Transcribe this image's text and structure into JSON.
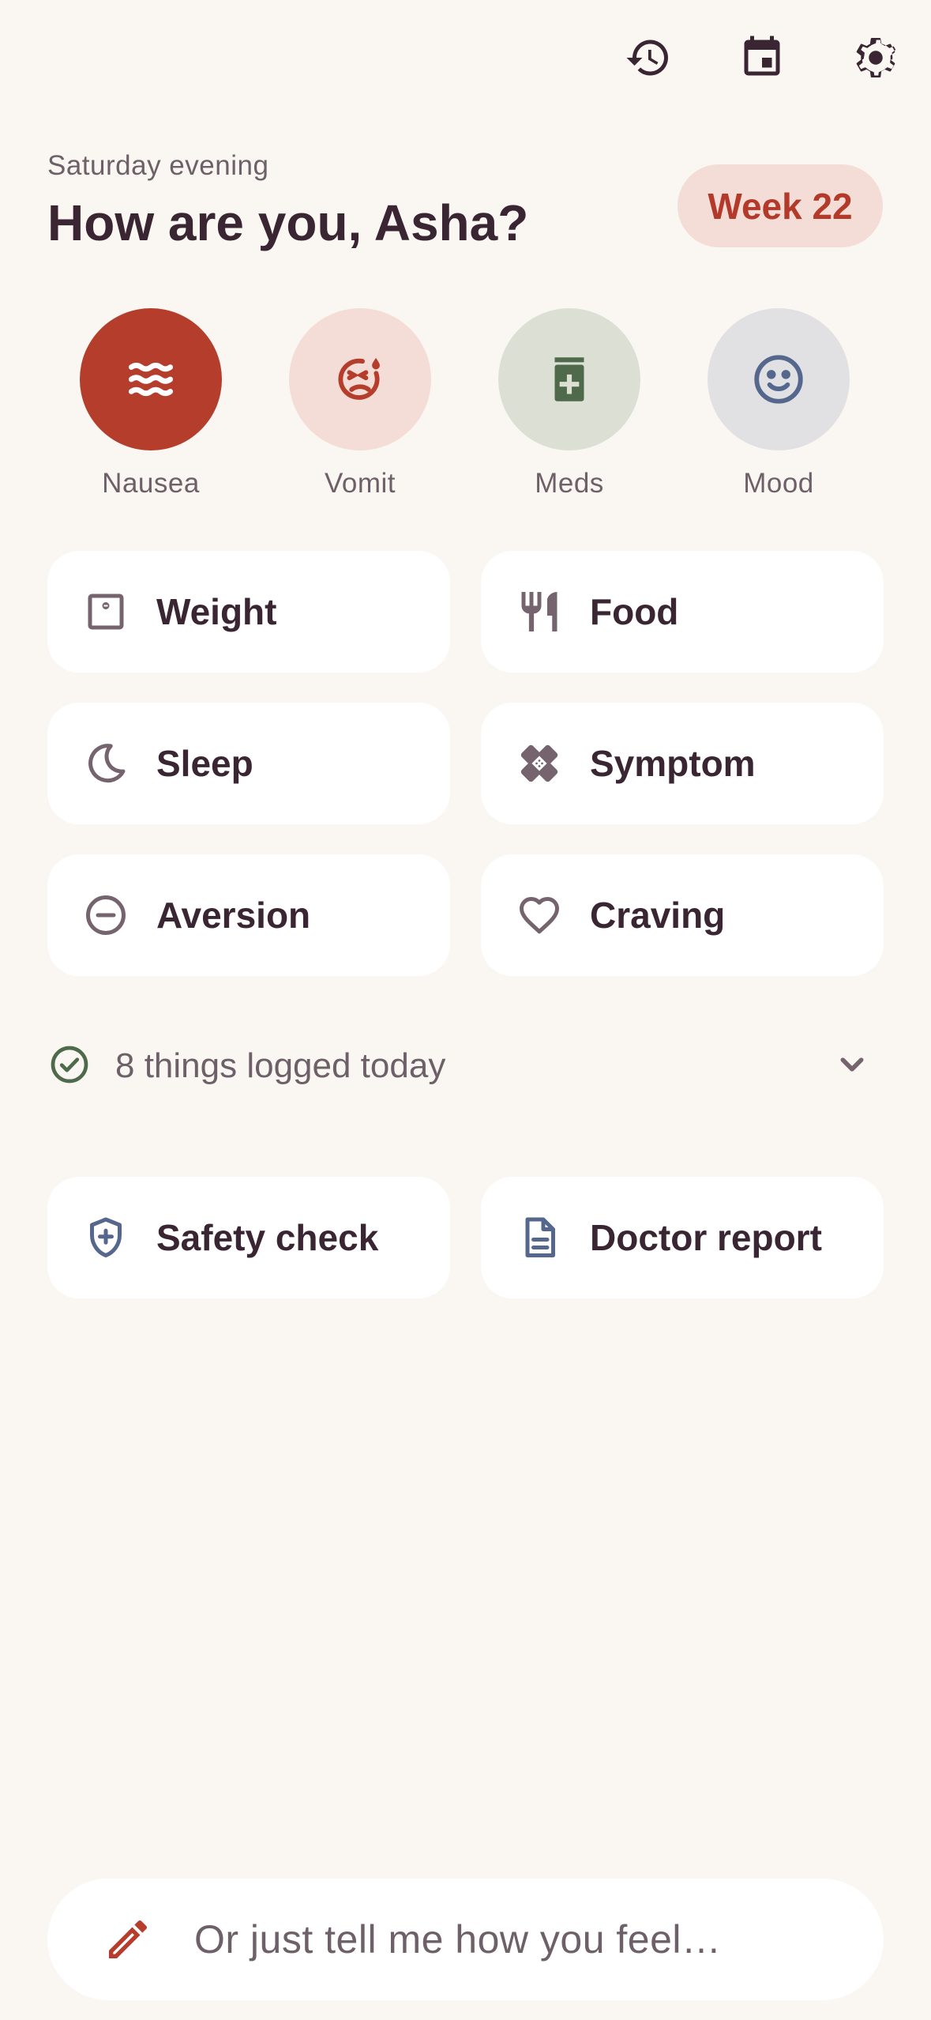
{
  "topbar": {
    "icons": [
      "history-icon",
      "calendar-icon",
      "settings-icon"
    ]
  },
  "header": {
    "subtitle": "Saturday evening",
    "title": "How are you, Asha?",
    "week_badge": "Week 22"
  },
  "quick_actions": [
    {
      "label": "Nausea",
      "icon": "waves-icon",
      "bg": "#B53D2C",
      "fg": "#FFFFFF"
    },
    {
      "label": "Vomit",
      "icon": "sick-face-icon",
      "bg": "#F3DDD6",
      "fg": "#B53D2C"
    },
    {
      "label": "Meds",
      "icon": "medication-icon",
      "bg": "#DCE0D4",
      "fg": "#4F6A4A"
    },
    {
      "label": "Mood",
      "icon": "smiley-icon",
      "bg": "#E1E1E3",
      "fg": "#56678E"
    }
  ],
  "tiles": [
    {
      "label": "Weight",
      "icon": "scale-icon"
    },
    {
      "label": "Food",
      "icon": "fork-knife-icon"
    },
    {
      "label": "Sleep",
      "icon": "moon-icon"
    },
    {
      "label": "Symptom",
      "icon": "bandage-icon"
    },
    {
      "label": "Aversion",
      "icon": "minus-circle-icon"
    },
    {
      "label": "Craving",
      "icon": "heart-icon"
    }
  ],
  "logged": {
    "text": "8 things logged today",
    "check_color": "#4F6A4A"
  },
  "actions": [
    {
      "label": "Safety check",
      "icon": "shield-plus-icon"
    },
    {
      "label": "Doctor report",
      "icon": "document-icon"
    }
  ],
  "input": {
    "placeholder": "Or just tell me how you feel…",
    "icon": "pencil-icon",
    "accent": "#B53D2C"
  },
  "colors": {
    "background": "#FAF6F2",
    "text": "#3A2633",
    "muted": "#6E6068",
    "accent": "#B33A2A",
    "badge_bg": "#F3DDD6",
    "icon_muted": "#75646E",
    "icon_blue": "#56678E"
  }
}
